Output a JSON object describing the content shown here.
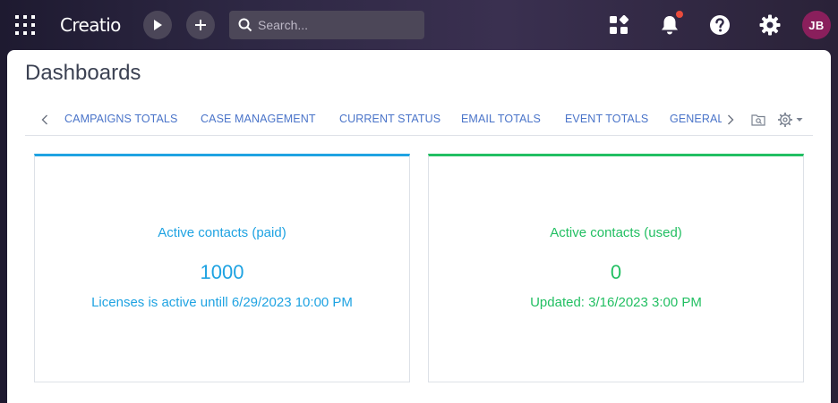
{
  "app": {
    "logo": "Creatio",
    "search_placeholder": "Search...",
    "user_initials": "JB",
    "accent": "#1fa3e2",
    "success": "#22bf62",
    "avatar_color": "#8a1f5c"
  },
  "page": {
    "title": "Dashboards"
  },
  "tabs": [
    {
      "label": "CAMPAIGNS TOTALS"
    },
    {
      "label": "CASE MANAGEMENT"
    },
    {
      "label": "CURRENT STATUS"
    },
    {
      "label": "EMAIL TOTALS"
    },
    {
      "label": "EVENT TOTALS"
    },
    {
      "label": "GENERAL"
    }
  ],
  "icons": {
    "apps": "grid-icon",
    "run": "play-icon",
    "add": "plus-icon",
    "search": "search-icon",
    "quick_access": "quick-access-icon",
    "notifications": "bell-icon",
    "help": "help-icon",
    "settings": "gear-icon"
  },
  "widgets": {
    "paid": {
      "title": "Active contacts (paid)",
      "value": "1000",
      "caption": "Licenses is active untill 6/29/2023 10:00 PM"
    },
    "used": {
      "title": "Active contacts (used)",
      "value": "0",
      "caption": "Updated: 3/16/2023 3:00 PM"
    }
  }
}
